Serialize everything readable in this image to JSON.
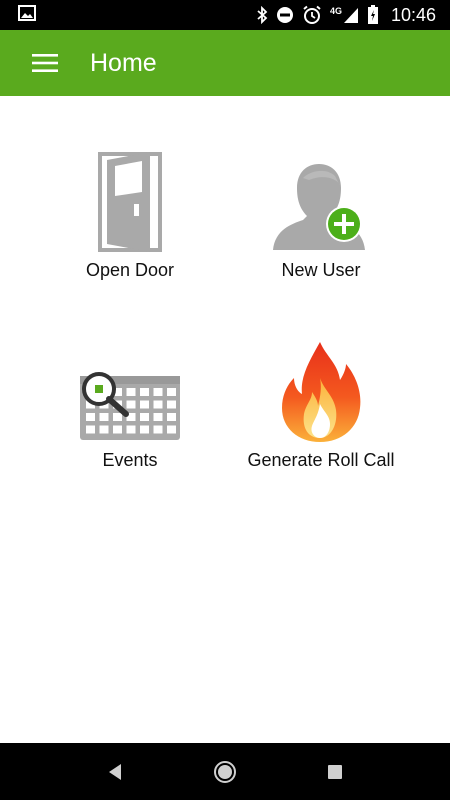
{
  "status_bar": {
    "time": "10:46",
    "network": "4G",
    "icons": [
      "image-icon",
      "bluetooth-icon",
      "do-not-disturb-icon",
      "alarm-icon",
      "signal-icon",
      "battery-icon"
    ]
  },
  "app_bar": {
    "title": "Home",
    "menu_icon": "menu-icon"
  },
  "tiles": [
    {
      "label": "Open Door",
      "icon": "door-icon"
    },
    {
      "label": "New User",
      "icon": "add-user-icon"
    },
    {
      "label": "Events",
      "icon": "calendar-search-icon"
    },
    {
      "label": "Generate Roll Call",
      "icon": "fire-icon"
    }
  ],
  "nav_bar": {
    "icons": [
      "back-icon",
      "home-icon",
      "recents-icon"
    ]
  },
  "colors": {
    "app_bar": "#5aaa1e",
    "accent_green": "#4caf1a",
    "icon_gray": "#a9a9a9"
  }
}
